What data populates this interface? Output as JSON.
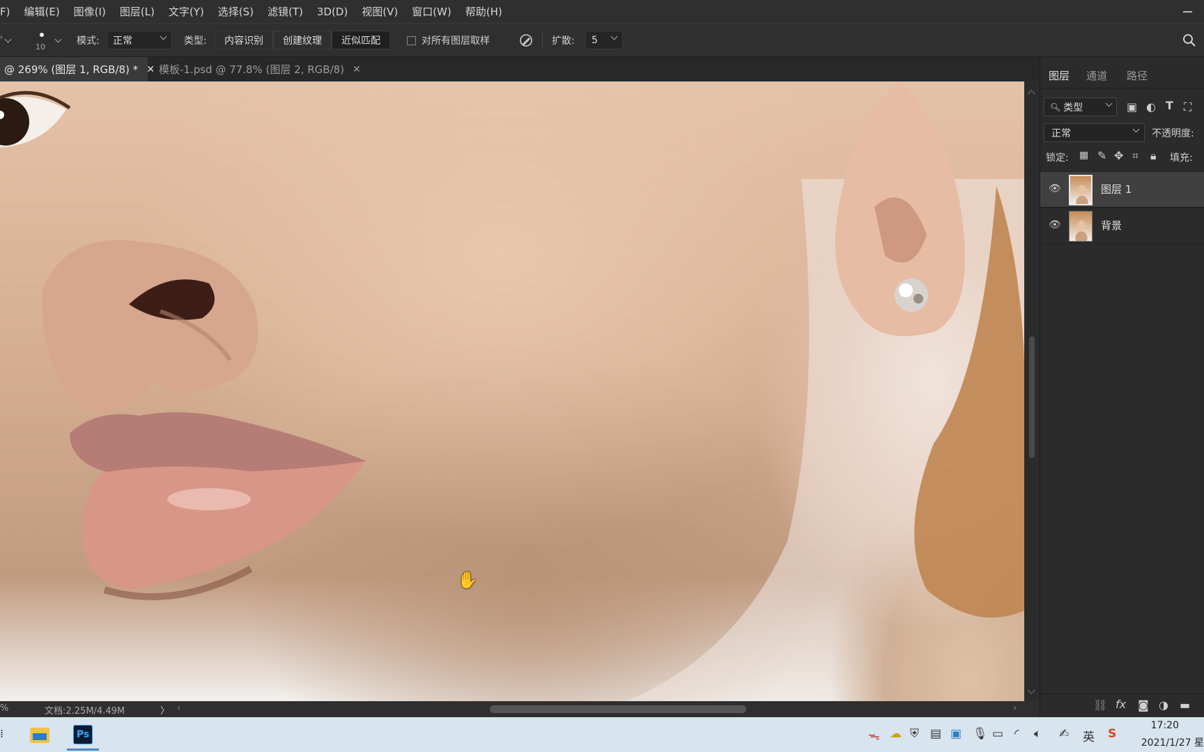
{
  "menubar": {
    "items": [
      "F)",
      "编辑(E)",
      "图像(I)",
      "图层(L)",
      "文字(Y)",
      "选择(S)",
      "滤镜(T)",
      "3D(D)",
      "视图(V)",
      "窗口(W)",
      "帮助(H)"
    ]
  },
  "options": {
    "brush_size": "10",
    "mode_label": "模式:",
    "mode_value": "正常",
    "type_label": "类型:",
    "type_buttons": [
      "内容识别",
      "创建纹理",
      "近似匹配"
    ],
    "type_selected": "近似匹配",
    "sample_all_label": "对所有图层取样",
    "sample_all_checked": false,
    "spread_label": "扩散:",
    "spread_value": "5"
  },
  "tabs": [
    {
      "label": "@ 269% (图层 1, RGB/8) *",
      "active": true
    },
    {
      "label": "模板-1.psd @ 77.8% (图层 2, RGB/8)",
      "active": false
    }
  ],
  "statusbar": {
    "zoom": "%",
    "doc_info": "文档:2.25M/4.49M"
  },
  "panel": {
    "tabs": [
      "图层",
      "通道",
      "路径"
    ],
    "active_tab": "图层",
    "filter_kind": "类型",
    "blend_mode": "正常",
    "opacity_label": "不透明度:",
    "lock_label": "锁定:",
    "fill_label": "填充:",
    "layers": [
      {
        "name": "图层 1",
        "visible": true,
        "selected": true
      },
      {
        "name": "背景",
        "visible": true,
        "selected": false
      }
    ]
  },
  "taskbar": {
    "apps": [
      "file-explorer-icon",
      "photoshop-icon"
    ],
    "ps_label": "Ps",
    "ime_label": "英",
    "time": "17:20",
    "date": "2021/1/27 星"
  },
  "colors": {
    "accent_ps": "#31a8ff",
    "taskbar_bg": "#d8e4ee",
    "ui_bg": "#2b2b2b"
  }
}
